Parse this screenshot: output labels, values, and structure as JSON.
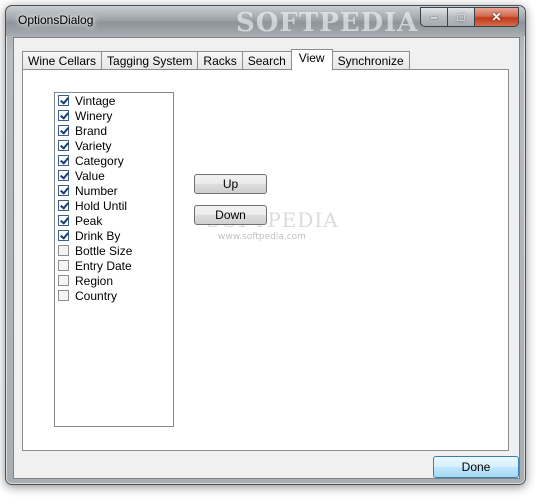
{
  "window": {
    "title": "OptionsDialog",
    "watermark": "SOFTPEDIA"
  },
  "tabs": [
    {
      "label": "Wine Cellars",
      "active": false
    },
    {
      "label": "Tagging System",
      "active": false
    },
    {
      "label": "Racks",
      "active": false
    },
    {
      "label": "Search",
      "active": false
    },
    {
      "label": "View",
      "active": true
    },
    {
      "label": "Synchronize",
      "active": false
    }
  ],
  "columns": [
    {
      "label": "Vintage",
      "checked": true
    },
    {
      "label": "Winery",
      "checked": true
    },
    {
      "label": "Brand",
      "checked": true
    },
    {
      "label": "Variety",
      "checked": true
    },
    {
      "label": "Category",
      "checked": true
    },
    {
      "label": "Value",
      "checked": true
    },
    {
      "label": "Number",
      "checked": true
    },
    {
      "label": "Hold Until",
      "checked": true
    },
    {
      "label": "Peak",
      "checked": true
    },
    {
      "label": "Drink By",
      "checked": true
    },
    {
      "label": "Bottle Size",
      "checked": false
    },
    {
      "label": "Entry Date",
      "checked": false
    },
    {
      "label": "Region",
      "checked": false
    },
    {
      "label": "Country",
      "checked": false
    }
  ],
  "buttons": {
    "up": "Up",
    "down": "Down",
    "done": "Done"
  },
  "center_watermark": {
    "big": "SOFTPEDIA",
    "small": "www.softpedia.com"
  }
}
